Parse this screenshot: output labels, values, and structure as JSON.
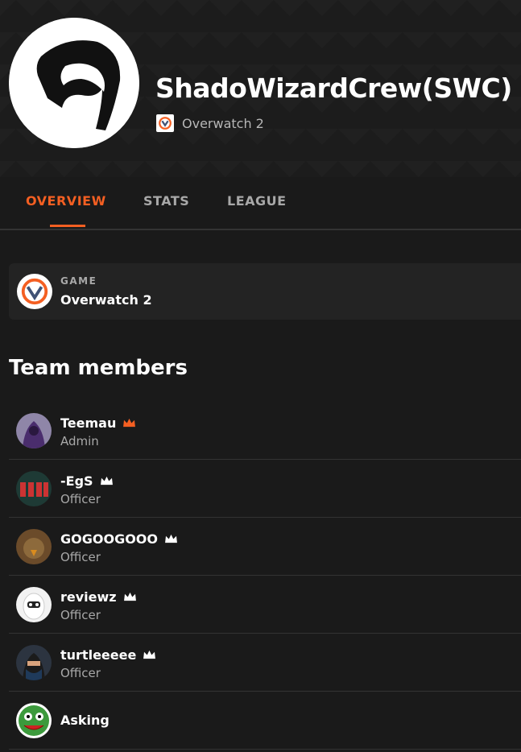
{
  "team": {
    "name": "ShadoWizardCrew(SWC)",
    "game": "Overwatch 2"
  },
  "tabs": [
    {
      "label": "OVERVIEW",
      "active": true
    },
    {
      "label": "STATS",
      "active": false
    },
    {
      "label": "LEAGUE",
      "active": false
    }
  ],
  "game_card": {
    "label": "GAME",
    "value": "Overwatch 2"
  },
  "members_title": "Team members",
  "members": [
    {
      "name": "Teemau",
      "role": "Admin",
      "crown": "orange"
    },
    {
      "name": "-EgS",
      "role": "Officer",
      "crown": "white"
    },
    {
      "name": "GOGOOGOOO",
      "role": "Officer",
      "crown": "white"
    },
    {
      "name": "reviewz",
      "role": "Officer",
      "crown": "white"
    },
    {
      "name": "turtleeeee",
      "role": "Officer",
      "crown": "white"
    },
    {
      "name": "Asking",
      "role": "",
      "crown": ""
    }
  ],
  "colors": {
    "accent": "#f45f22",
    "background": "#1a1a1a",
    "card": "#232323"
  }
}
